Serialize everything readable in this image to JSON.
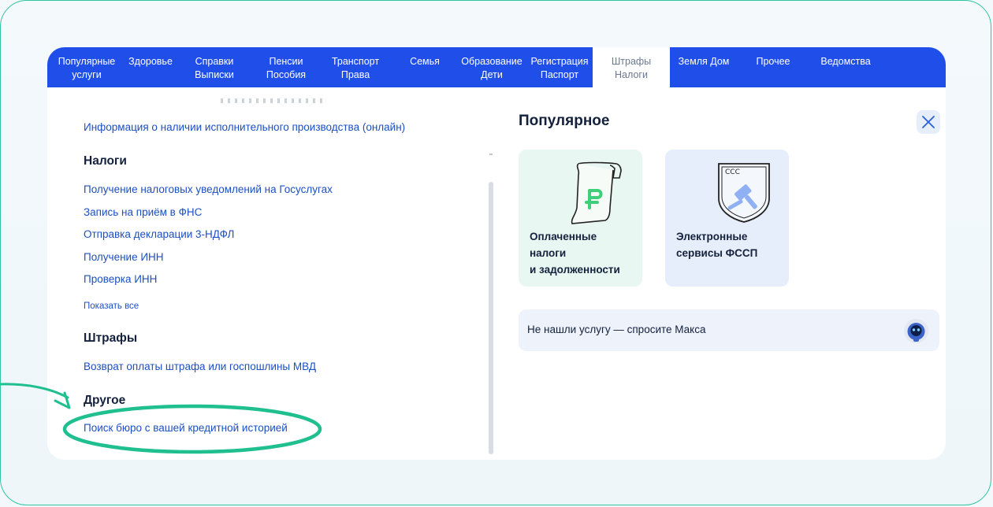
{
  "nav": {
    "items": [
      {
        "label": "Популярные\nуслуги",
        "active": false
      },
      {
        "label": "Здоровье",
        "active": false
      },
      {
        "label": "Справки\nВыписки",
        "active": false
      },
      {
        "label": "Пенсии\nПособия",
        "active": false
      },
      {
        "label": "Транспорт\nПрава",
        "active": false
      },
      {
        "label": "Семья",
        "active": false
      },
      {
        "label": "Образование\nДети",
        "active": false
      },
      {
        "label": "Регистрация\nПаспорт",
        "active": false
      },
      {
        "label": "Штрафы\nНалоги",
        "active": true
      },
      {
        "label": "Земля Дом",
        "active": false
      },
      {
        "label": "Прочее",
        "active": false
      },
      {
        "label": "Ведомства",
        "active": false
      }
    ]
  },
  "left": {
    "top_link": "Информация о наличии исполнительного производства (онлайн)",
    "sections": {
      "taxes": {
        "title": "Налоги",
        "links": [
          "Получение налоговых уведомлений на Госуслугах",
          "Запись на приём в ФНС",
          "Отправка декларации 3-НДФЛ",
          "Получение ИНН",
          "Проверка ИНН"
        ],
        "show_all": "Показать все"
      },
      "fines": {
        "title": "Штрафы",
        "links": [
          "Возврат оплаты штрафа или госпошлины МВД"
        ]
      },
      "other": {
        "title": "Другое",
        "links": [
          "Поиск бюро с вашей кредитной историей"
        ]
      }
    }
  },
  "right": {
    "title": "Популярное",
    "cards": [
      {
        "label": "Оплаченные\nналоги\nи задолженности",
        "icon": "receipt-ruble-icon"
      },
      {
        "label": "Электронные\nсервисы ФССП",
        "icon": "fssp-shield-gavel-icon"
      }
    ],
    "ask": {
      "text": "Не нашли услугу — спросите Макса",
      "icon": "max-robot-avatar"
    }
  },
  "colors": {
    "nav_bg": "#1f4ee8",
    "link": "#1c4fc4",
    "highlight": "#1fbf8f",
    "frame_border": "#2ec4a0"
  }
}
